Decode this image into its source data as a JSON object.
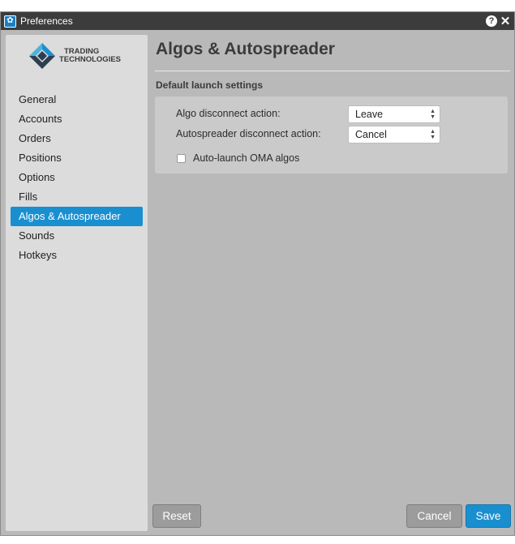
{
  "window": {
    "title": "Preferences",
    "app_icon": "tt-logo-icon",
    "help_icon": "?",
    "close_icon": "✕"
  },
  "logo": {
    "line1": "TRADING",
    "line2": "TECHNOLOGIES",
    "colors": {
      "dark": "#2c3e50",
      "blue": "#1a8fd0",
      "teal": "#4fb3d9"
    }
  },
  "sidebar": {
    "items": [
      {
        "label": "General"
      },
      {
        "label": "Accounts"
      },
      {
        "label": "Orders"
      },
      {
        "label": "Positions"
      },
      {
        "label": "Options"
      },
      {
        "label": "Fills"
      },
      {
        "label": "Algos & Autospreader",
        "active": true
      },
      {
        "label": "Sounds"
      },
      {
        "label": "Hotkeys"
      }
    ]
  },
  "main": {
    "title": "Algos & Autospreader",
    "section_title": "Default launch settings",
    "settings": {
      "algo_disconnect_label": "Algo disconnect action:",
      "algo_disconnect_value": "Leave",
      "autospreader_disconnect_label": "Autospreader disconnect action:",
      "autospreader_disconnect_value": "Cancel",
      "auto_launch_label": "Auto-launch OMA algos",
      "auto_launch_checked": false
    }
  },
  "footer": {
    "reset_label": "Reset",
    "cancel_label": "Cancel",
    "save_label": "Save"
  },
  "colors": {
    "accent": "#1a8fd0",
    "titlebar": "#3c3c3c",
    "sidebar_bg": "#dcdcdc",
    "window_bg": "#b9b9b9"
  }
}
